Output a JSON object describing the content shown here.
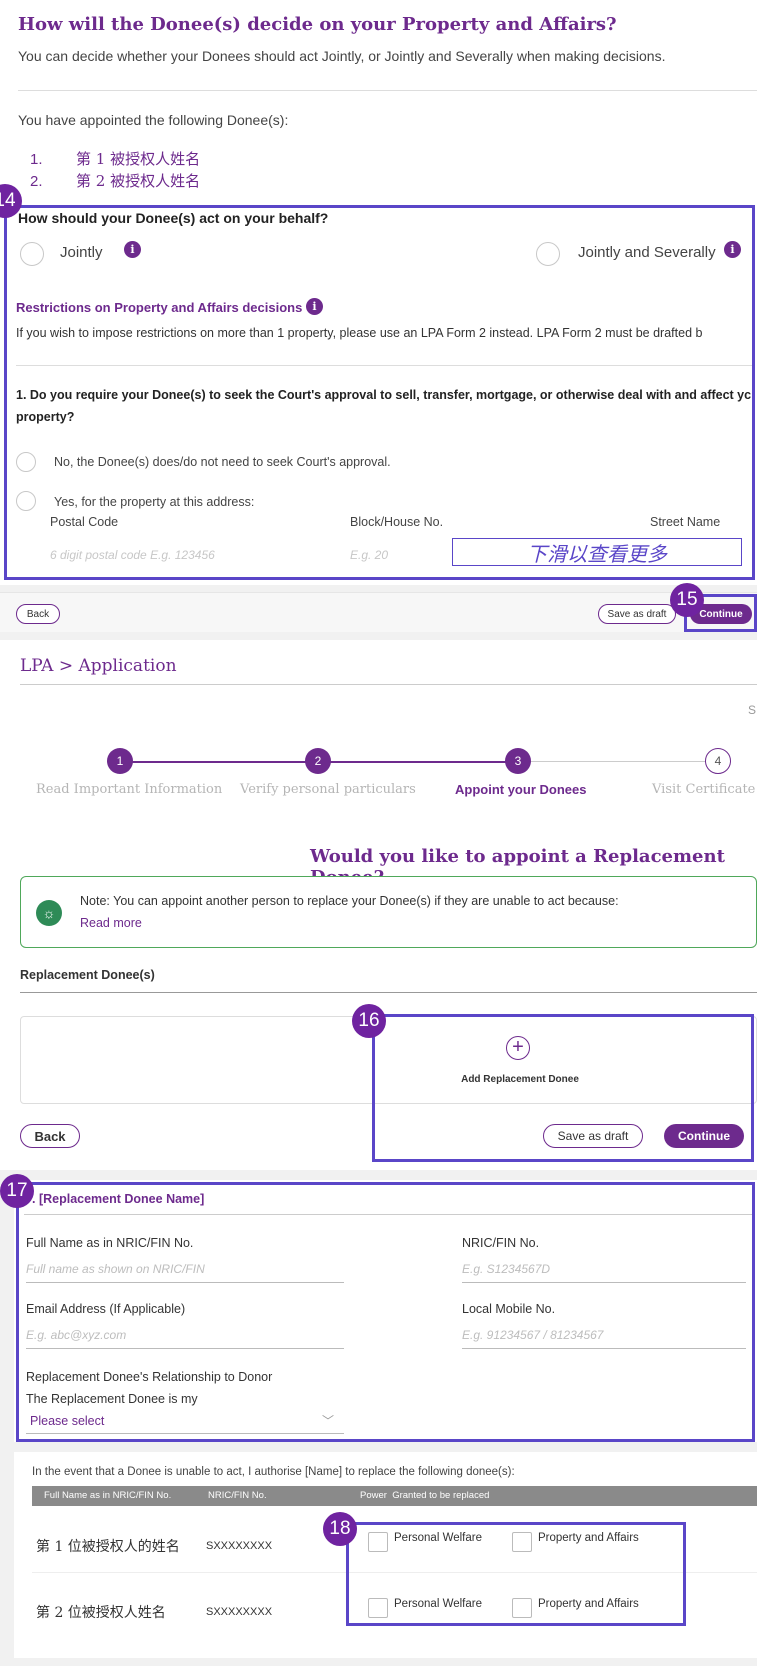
{
  "section1": {
    "title": "How will the Donee(s) decide on your Property and Affairs?",
    "subtitle": "You can decide whether your Donees should act Jointly, or Jointly and Severally when making decisions.",
    "appointed_label": "You have appointed the following Donee(s):",
    "donees": [
      {
        "num": "1.",
        "name": "第 1 被授权人姓名"
      },
      {
        "num": "2.",
        "name": "第 2 被授权人姓名"
      }
    ],
    "act_question": "How should your Donee(s) act on your behalf?",
    "option_jointly": "Jointly",
    "option_jointly_severally": "Jointly and Severally",
    "restrictions_title": "Restrictions on Property and Affairs decisions",
    "restrictions_text": "If you wish to impose restrictions on more than 1 property, please use an LPA Form 2 instead. LPA Form 2 must be drafted b",
    "court_question_line1": "1. Do you require your Donee(s) to seek the Court's approval to sell, transfer, mortgage, or otherwise deal with and affect yc",
    "court_question_line2": "property?",
    "court_no": "No, the Donee(s) does/do not need to seek Court's approval.",
    "court_yes": "Yes, for the property at this address:",
    "postal_label": "Postal Code",
    "postal_ph": "6 digit postal code E.g. 123456",
    "block_label": "Block/House No.",
    "block_ph": "E.g. 20",
    "street_label": "Street Name",
    "scroll_hint": "下滑以查看更多",
    "back": "Back",
    "save_draft": "Save as draft",
    "continue": "Continue"
  },
  "badges": {
    "b14": "14",
    "b15": "15",
    "b16": "16",
    "b17": "17",
    "b18": "18"
  },
  "section2": {
    "breadcrumb": "LPA > Application",
    "edge_letter": "S",
    "steps": [
      {
        "num": "1",
        "label": "Read Important Information"
      },
      {
        "num": "2",
        "label": "Verify personal particulars"
      },
      {
        "num": "3",
        "label": "Appoint your Donees"
      },
      {
        "num": "4",
        "label": "Visit Certificate Is"
      }
    ],
    "question": "Would you like to appoint a Replacement Donee?",
    "note": "Note: You can appoint another person to replace your Donee(s) if they are unable to act because:",
    "read_more": "Read more",
    "replacement_label": "Replacement Donee(s)",
    "add_replacement": "Add Replacement Donee",
    "back": "Back",
    "save_draft": "Save as draft",
    "continue": "Continue"
  },
  "section3": {
    "title": ". [Replacement Donee Name]",
    "fullname_label": "Full Name as in NRIC/FIN No.",
    "fullname_ph": "Full name as shown on NRIC/FIN",
    "nric_label": "NRIC/FIN No.",
    "nric_ph": "E.g. S1234567D",
    "email_label": "Email Address (If Applicable)",
    "email_ph": "E.g. abc@xyz.com",
    "mobile_label": "Local Mobile No.",
    "mobile_ph": "E.g. 91234567 / 81234567",
    "relationship_label": "Replacement Donee's Relationship to Donor",
    "relationship_sub": "The Replacement Donee is my",
    "relationship_select": "Please select"
  },
  "section4": {
    "intro": "In the event that a Donee is unable to act, I authorise [Name] to replace the following donee(s):",
    "headers": [
      "Full Name as in NRIC/FIN No.",
      "NRIC/FIN No.",
      "Power  Granted to be replaced"
    ],
    "rows": [
      {
        "name": "第 1 位被授权人的姓名",
        "nric": "SXXXXXXXX",
        "opt1": "Personal Welfare",
        "opt2": "Property and Affairs"
      },
      {
        "name": "第 2 位被授权人姓名",
        "nric": "SXXXXXXXX",
        "opt1": "Personal Welfare",
        "opt2": "Property and Affairs"
      }
    ]
  }
}
